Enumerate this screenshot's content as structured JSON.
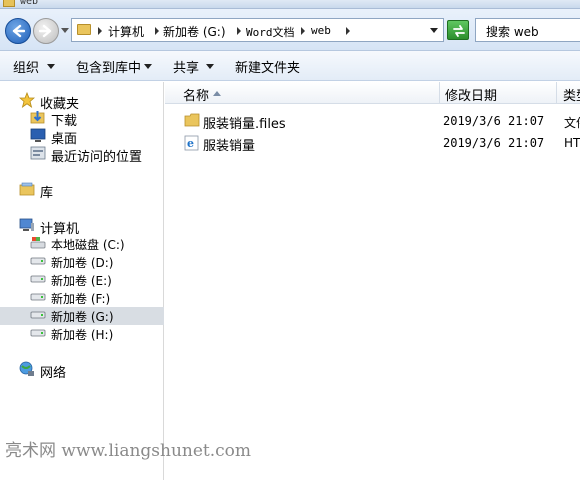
{
  "window": {
    "title": "web"
  },
  "address": {
    "crumbs": [
      "计算机",
      "新加卷 (G:)",
      "Word文档",
      "web"
    ]
  },
  "search": {
    "placeholder": "搜索 web"
  },
  "toolbar": {
    "organize": "组织",
    "include_library": "包含到库中",
    "share": "共享",
    "new_folder": "新建文件夹"
  },
  "navpane": {
    "favorites": "收藏夹",
    "downloads": "下载",
    "desktop": "桌面",
    "recent": "最近访问的位置",
    "libraries": "库",
    "computer": "计算机",
    "drives": [
      {
        "label": "本地磁盘 (C:)"
      },
      {
        "label": "新加卷 (D:)"
      },
      {
        "label": "新加卷 (E:)"
      },
      {
        "label": "新加卷 (F:)"
      },
      {
        "label": "新加卷 (G:)",
        "selected": true
      },
      {
        "label": "新加卷 (H:)"
      }
    ],
    "network": "网络"
  },
  "columns": {
    "name": "名称",
    "date_modified": "修改日期",
    "type": "类型"
  },
  "files": [
    {
      "name": "服装销量.files",
      "date": "2019/3/6 21:07",
      "type": "文件",
      "icon": "folder-icon"
    },
    {
      "name": "服装销量",
      "date": "2019/3/6 21:07",
      "type": "HTM",
      "icon": "ie-html-icon"
    }
  ],
  "watermark": "亮术网 www.liangshunet.com",
  "colors": {
    "selection": "#d8dde3",
    "nav_gradient_top": "#e9f1fb",
    "folder": "#eac55d"
  }
}
